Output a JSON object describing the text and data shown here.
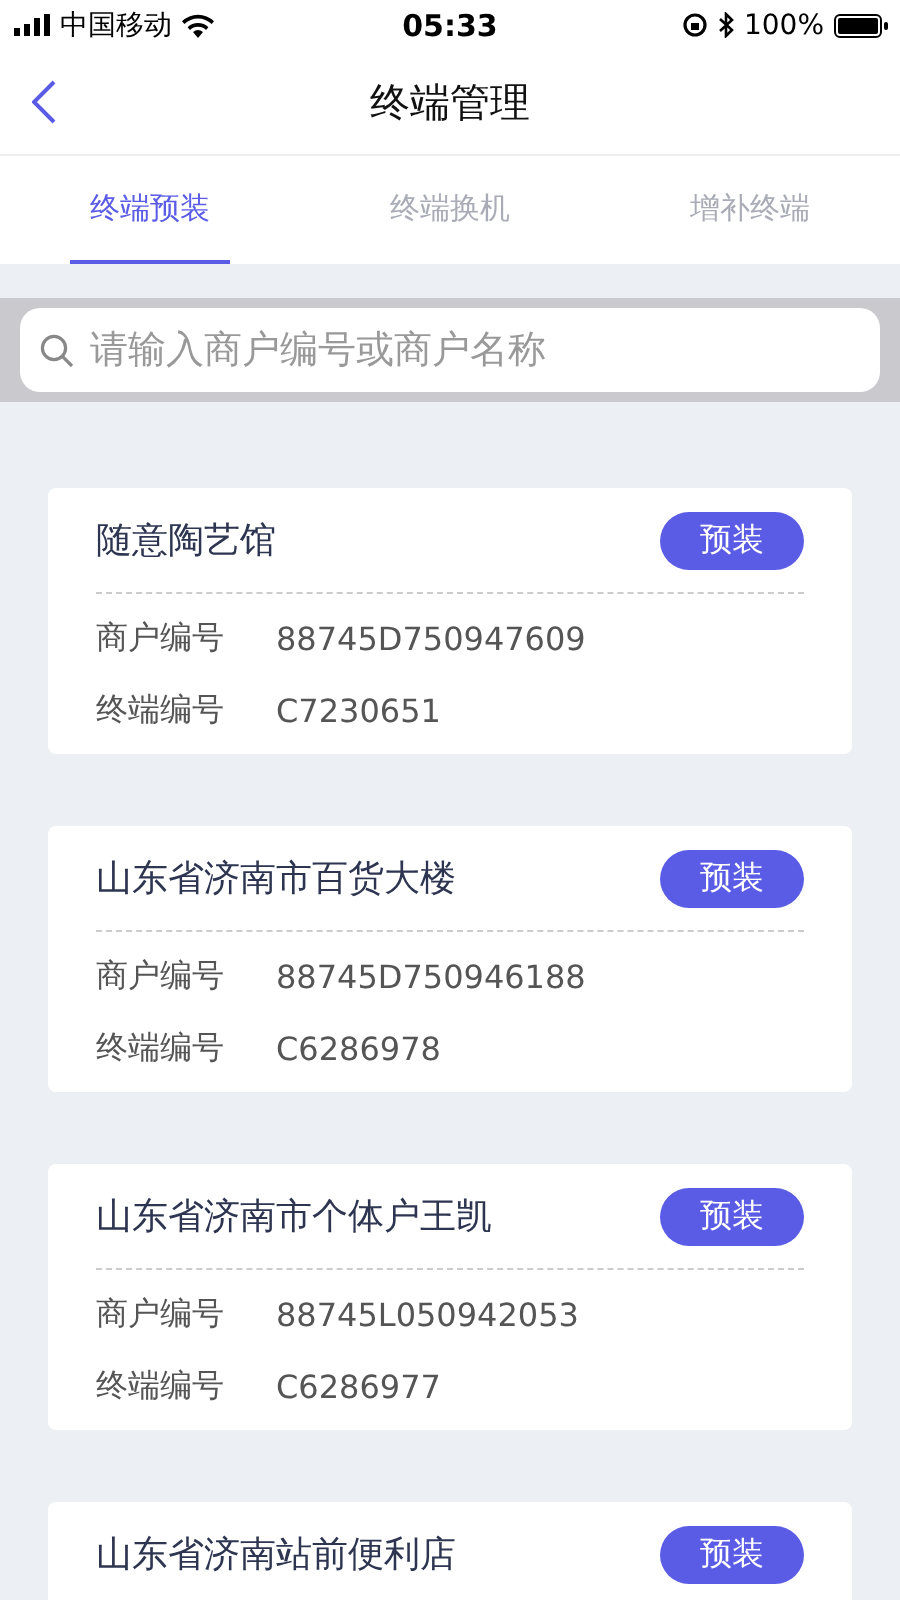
{
  "status_bar": {
    "carrier": "中国移动",
    "time": "05:33",
    "battery": "100%"
  },
  "nav": {
    "title": "终端管理"
  },
  "tabs": [
    {
      "label": "终端预装",
      "selected": true
    },
    {
      "label": "终端换机",
      "selected": false
    },
    {
      "label": "增补终端",
      "selected": false
    }
  ],
  "search": {
    "placeholder": "请输入商户编号或商户名称"
  },
  "merchants": [
    {
      "name": "随意陶艺馆",
      "action": "预装",
      "fields": [
        {
          "label": "商户编号",
          "value": "88745D750947609"
        },
        {
          "label": "终端编号",
          "value": "C7230651"
        }
      ]
    },
    {
      "name": "山东省济南市百货大楼",
      "action": "预装",
      "fields": [
        {
          "label": "商户编号",
          "value": "88745D750946188"
        },
        {
          "label": "终端编号",
          "value": "C6286978"
        }
      ]
    },
    {
      "name": "山东省济南市个体户王凯",
      "action": "预装",
      "fields": [
        {
          "label": "商户编号",
          "value": "88745L050942053"
        },
        {
          "label": "终端编号",
          "value": "C6286977"
        }
      ]
    },
    {
      "name": "山东省济南站前便利店",
      "action": "预装"
    }
  ]
}
